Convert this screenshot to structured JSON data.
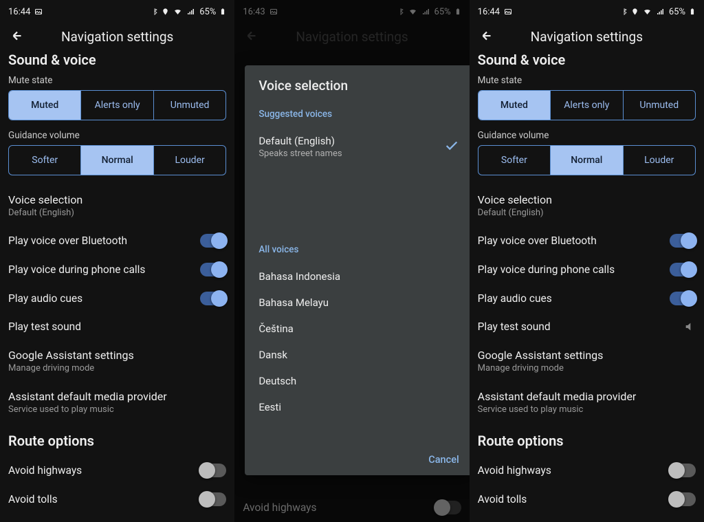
{
  "status": {
    "time1": "16:44",
    "time2": "16:43",
    "battery": "65%"
  },
  "title": "Navigation settings",
  "sec_sound": "Sound & voice",
  "mute": {
    "label": "Mute state",
    "opts": [
      "Muted",
      "Alerts only",
      "Unmuted"
    ],
    "sel": 0
  },
  "vol": {
    "label": "Guidance volume",
    "opts": [
      "Softer",
      "Normal",
      "Louder"
    ],
    "sel": 1
  },
  "voice": {
    "title": "Voice selection",
    "value": "Default (English)"
  },
  "tog": {
    "bt": "Play voice over Bluetooth",
    "calls": "Play voice during phone calls",
    "cues": "Play audio cues"
  },
  "test": "Play test sound",
  "ga": {
    "title": "Google Assistant settings",
    "sub": "Manage driving mode"
  },
  "media": {
    "title": "Assistant default media provider",
    "sub": "Service used to play music"
  },
  "route": {
    "sec": "Route options",
    "hw": "Avoid highways",
    "tolls": "Avoid tolls"
  },
  "dialog": {
    "title": "Voice selection",
    "grp1": "Suggested voices",
    "def": {
      "label": "Default (English)",
      "sub": "Speaks street names"
    },
    "grp2": "All voices",
    "langs": [
      "Bahasa Indonesia",
      "Bahasa Melayu",
      "Čeština",
      "Dansk",
      "Deutsch",
      "Eesti"
    ],
    "cancel": "Cancel"
  }
}
